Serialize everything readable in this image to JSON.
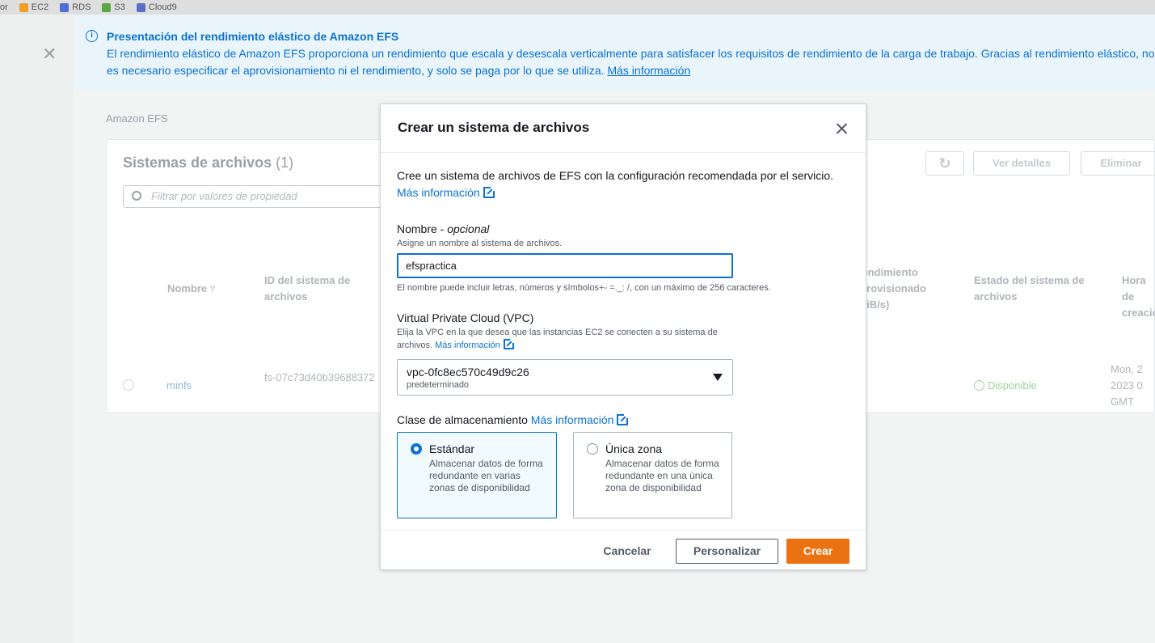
{
  "bookmarks": [
    {
      "label": "or",
      "icon": "none",
      "color": ""
    },
    {
      "label": "EC2",
      "icon": "ec2-icon",
      "color": "#f0a020"
    },
    {
      "label": "RDS",
      "icon": "rds-icon",
      "color": "#4a6fd8"
    },
    {
      "label": "S3",
      "icon": "s3-icon",
      "color": "#5aa845"
    },
    {
      "label": "Cloud9",
      "icon": "cloud9-icon",
      "color": "#5a6ec8"
    }
  ],
  "banner": {
    "title": "Presentación del rendimiento elástico de Amazon EFS",
    "body": "El rendimiento elástico de Amazon EFS proporciona un rendimiento que escala y desescala verticalmente para satisfacer los requisitos de rendimiento de la carga de trabajo. Gracias al rendimiento elástico, no es necesario especificar el aprovisionamiento ni el rendimiento, y solo se paga por lo que se utiliza.",
    "link": "Más información"
  },
  "breadcrumb": "Amazon EFS",
  "list": {
    "title": "Sistemas de archivos",
    "count": "(1)",
    "filter_placeholder": "Filtrar por valores de propiedad",
    "view_details": "Ver detalles",
    "delete": "Eliminar",
    "columns": {
      "name": "Nombre",
      "id": "ID del sistema de archivos",
      "throughput": "Rendimiento aprovisionado (MiB/s)",
      "state": "Estado del sistema de archivos",
      "created": "Hora de creación"
    },
    "row": {
      "name": "minfs",
      "id": "fs-07c73d40b39688372",
      "state": "Disponible",
      "created": "Mon, 2 2023 0 GMT"
    }
  },
  "modal": {
    "title": "Crear un sistema de archivos",
    "intro": "Cree un sistema de archivos de EFS con la configuración recomendada por el servicio.",
    "intro_link": "Más información",
    "name_label": "Nombre - ",
    "name_optional": "opcional",
    "name_desc": "Asigne un nombre al sistema de archivos.",
    "name_value": "efspractica",
    "name_constraint": "El nombre puede incluir letras, números y símbolos+- =._: /, con un máximo de 256 caracteres.",
    "vpc_label": "Virtual Private Cloud (VPC)",
    "vpc_desc_line1": "Elija la VPC en la que desea que las instancias EC2 se conecten a su sistema de",
    "vpc_desc_line2": "archivos.",
    "vpc_link": "Más información",
    "vpc_value": "vpc-0fc8ec570c49d9c26",
    "vpc_sub": "predeterminado",
    "storage_label": "Clase de almacenamiento",
    "storage_link": "Más información",
    "storage_options": [
      {
        "title": "Estándar",
        "desc": "Almacenar datos de forma redundante en varias zonas de disponibilidad",
        "selected": true
      },
      {
        "title": "Única zona",
        "desc": "Almacenar datos de forma redundante en una única zona de disponibilidad",
        "selected": false
      }
    ],
    "cancel": "Cancelar",
    "customize": "Personalizar",
    "create": "Crear"
  },
  "colors": {
    "accent": "#0972d3",
    "primary_button": "#ec7211",
    "banner_bg": "#eaf4fb"
  }
}
